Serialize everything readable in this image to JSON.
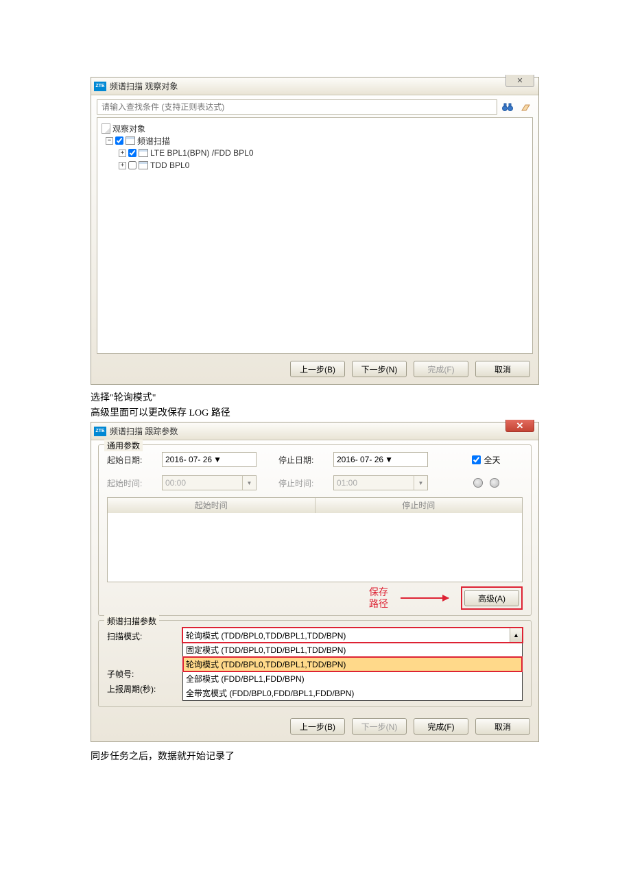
{
  "dialog1": {
    "title": "频谱扫描 观察对象",
    "search_placeholder": "请输入查找条件 (支持正则表达式)",
    "tree": {
      "root": "观察对象",
      "node1": "频谱扫描",
      "leaf1": "LTE BPL1(BPN) /FDD BPL0",
      "leaf2": "TDD BPL0"
    }
  },
  "buttons": {
    "back": "上一步(B)",
    "next": "下一步(N)",
    "finish": "完成(F)",
    "cancel": "取消",
    "advanced": "高级(A)"
  },
  "text_between": {
    "line1": "选择\"轮询模式\"",
    "line2": "高级里面可以更改保存 LOG 路径"
  },
  "dialog2": {
    "title": "频谱扫描 跟踪参数",
    "group1_title": "通用参数",
    "group2_title": "频谱扫描参数",
    "labels": {
      "start_date": "起始日期:",
      "stop_date": "停止日期:",
      "start_time": "起始时间:",
      "stop_time": "停止时间:",
      "allday": "全天",
      "col1": "起始时间",
      "col2": "停止时间",
      "scan_mode": "扫描模式:",
      "subframe": "子帧号:",
      "report_period": "上报周期(秒):"
    },
    "values": {
      "start_date": "2016- 07- 26",
      "stop_date": "2016- 07- 26",
      "start_time": "00:00",
      "stop_time": "01:00",
      "scan_mode_selected": "轮询模式 (TDD/BPL0,TDD/BPL1,TDD/BPN)"
    },
    "options": [
      "固定模式 (TDD/BPL0,TDD/BPL1,TDD/BPN)",
      "轮询模式 (TDD/BPL0,TDD/BPL1,TDD/BPN)",
      "全部模式 (FDD/BPL1,FDD/BPN)",
      "全带宽模式 (FDD/BPL0,FDD/BPL1,FDD/BPN)"
    ],
    "annotation": {
      "l1": "保存",
      "l2": "路径"
    }
  },
  "text_after": "同步任务之后，数据就开始记录了"
}
